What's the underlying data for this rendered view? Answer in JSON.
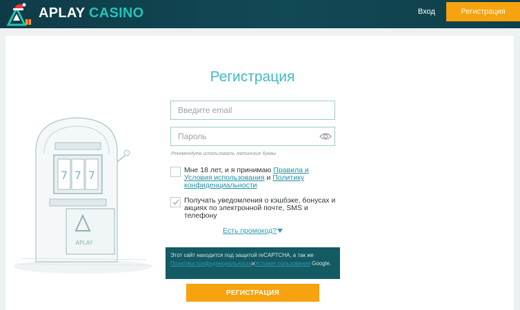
{
  "header": {
    "brand_white": "APLAY",
    "brand_colored": "CASINO",
    "login_label": "Вход",
    "register_label": "Регистрация"
  },
  "illustration": {
    "machine_label": "APLAY"
  },
  "form": {
    "title": "Регистрация",
    "email_placeholder": "Введите email",
    "password_placeholder": "Пароль",
    "password_hint": "Рекомендуем использовать латинские буквы",
    "age_consent": {
      "checked": false,
      "text_prefix": "Мне 18 лет, и я принимаю ",
      "rules_link": "Правила и Условия использования",
      "middle": " и ",
      "privacy_link": "Политику конфиденциальности"
    },
    "notifications": {
      "checked": true,
      "text": "Получать уведомления о кэшбэке, бонусах и акциях по электронной почте, SMS и телефону"
    },
    "promo_label": "Есть промокод?",
    "recaptcha": {
      "prefix": "Этот сайт находится под защитой reCAPTCHA, а так же ",
      "privacy_link": "Политика конфиденциальности",
      "conj": "и",
      "terms_link": "Условия пользования",
      "suffix": " Google."
    },
    "submit_label": "РЕГИСТРАЦИЯ"
  },
  "colors": {
    "header_bg": "#114955",
    "accent_teal": "#22c6b8",
    "button_orange": "#f7a20f",
    "recaptcha_bg": "#135a63"
  }
}
